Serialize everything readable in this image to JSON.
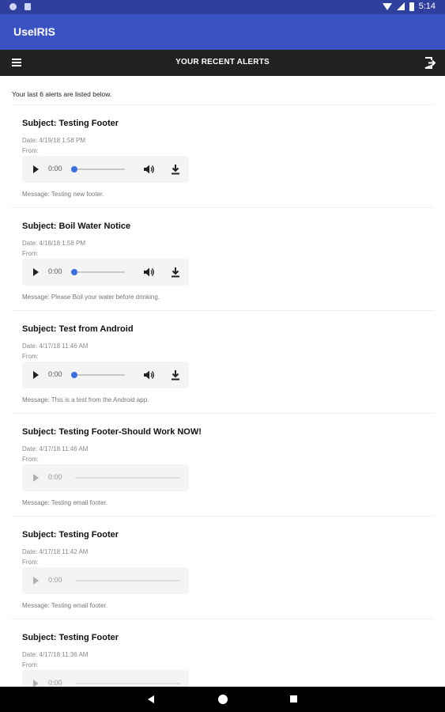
{
  "status_bar": {
    "time": "5:14",
    "bg_color": "#2e3f9e"
  },
  "app": {
    "title": "UseIRIS",
    "accent_color": "#3b52c2"
  },
  "toolbar": {
    "title": "YOUR RECENT ALERTS",
    "menu_icon": "hamburger-menu-icon",
    "logout_icon": "logout-icon"
  },
  "intro_text": "Your last 6 alerts are listed below.",
  "alerts": [
    {
      "subject": "Subject: Testing Footer",
      "date": "Date: 4/19/18 1:58 PM",
      "from": "From:",
      "player": {
        "time": "0:00",
        "enabled": true,
        "progress": 0
      },
      "message": "Message: Testing new footer."
    },
    {
      "subject": "Subject: Boil Water Notice",
      "date": "Date: 4/18/18 1:58 PM",
      "from": "From:",
      "player": {
        "time": "0:00",
        "enabled": true,
        "progress": 0
      },
      "message": "Message: Please Boil your water before drinking."
    },
    {
      "subject": "Subject: Test from Android",
      "date": "Date: 4/17/18 11:46 AM",
      "from": "From:",
      "player": {
        "time": "0:00",
        "enabled": true,
        "progress": 0
      },
      "message": "Message: This is a test from the Android app."
    },
    {
      "subject": "Subject: Testing Footer-Should Work NOW!",
      "date": "Date: 4/17/18 11:46 AM",
      "from": "From:",
      "player": {
        "time": "0:00",
        "enabled": false,
        "progress": 0
      },
      "message": "Message: Testing email footer."
    },
    {
      "subject": "Subject: Testing Footer",
      "date": "Date: 4/17/18 11:42 AM",
      "from": "From:",
      "player": {
        "time": "0:00",
        "enabled": false,
        "progress": 0
      },
      "message": "Message: Testing email footer."
    },
    {
      "subject": "Subject: Testing Footer",
      "date": "Date: 4/17/18 11:36 AM",
      "from": "From:",
      "player": {
        "time": "0:00",
        "enabled": false,
        "progress": 0
      },
      "message": ""
    }
  ],
  "nav_bar": {
    "back_icon": "back-triangle-icon",
    "home_icon": "home-circle-icon",
    "recent_icon": "recent-apps-square-icon"
  }
}
